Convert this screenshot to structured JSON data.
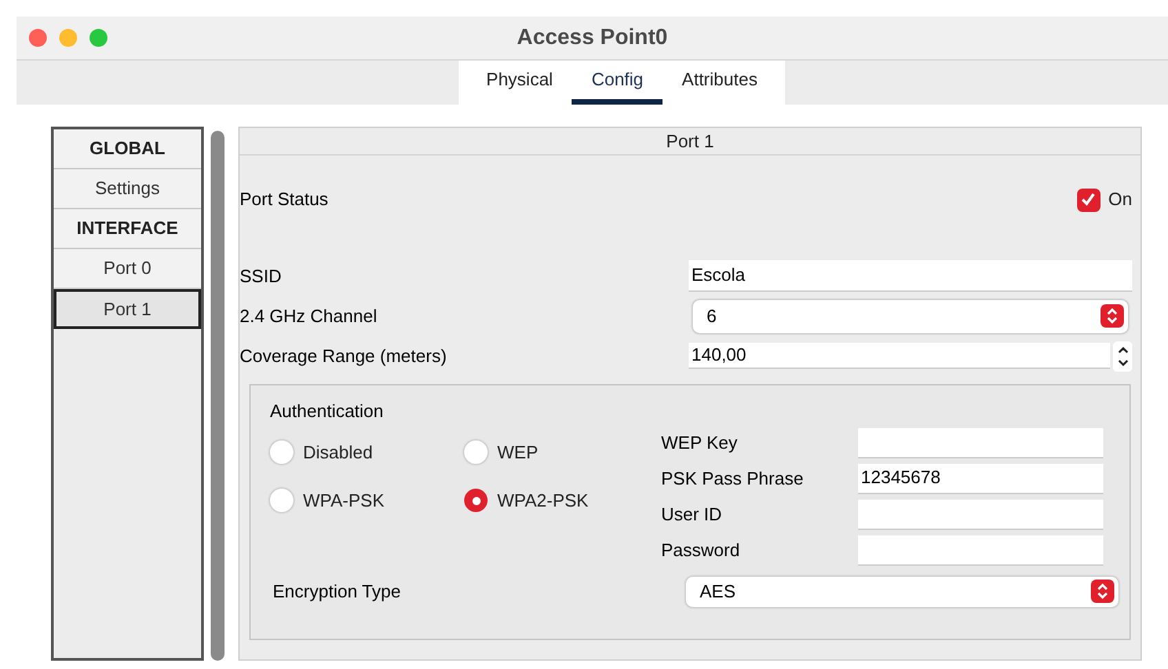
{
  "window": {
    "title": "Access Point0"
  },
  "tabs": [
    {
      "label": "Physical",
      "selected": false
    },
    {
      "label": "Config",
      "selected": true
    },
    {
      "label": "Attributes",
      "selected": false
    }
  ],
  "sidebar": {
    "items": [
      {
        "label": "GLOBAL",
        "kind": "header",
        "selected": false
      },
      {
        "label": "Settings",
        "kind": "item",
        "selected": false
      },
      {
        "label": "INTERFACE",
        "kind": "header",
        "selected": false
      },
      {
        "label": "Port 0",
        "kind": "item",
        "selected": false
      },
      {
        "label": "Port 1",
        "kind": "item",
        "selected": true
      }
    ]
  },
  "panel": {
    "title": "Port 1",
    "port_status": {
      "label": "Port Status",
      "checkbox_label": "On",
      "checked": true
    },
    "settings": [
      {
        "label": "SSID",
        "kind": "text",
        "value": "Escola"
      },
      {
        "label": "2.4 GHz Channel",
        "kind": "select",
        "value": "6"
      },
      {
        "label": "Coverage Range (meters)",
        "kind": "spinner",
        "value": "140,00"
      }
    ],
    "authentication": {
      "title": "Authentication",
      "options": [
        {
          "label": "Disabled",
          "selected": false
        },
        {
          "label": "WEP",
          "selected": false
        },
        {
          "label": "WPA-PSK",
          "selected": false
        },
        {
          "label": "WPA2-PSK",
          "selected": true
        }
      ],
      "fields": [
        {
          "label": "WEP Key"
        },
        {
          "label": "PSK Pass Phrase",
          "value": "12345678"
        },
        {
          "label": "User ID"
        },
        {
          "label": "Password"
        }
      ],
      "encryption": {
        "label": "Encryption Type",
        "value": "AES"
      }
    }
  }
}
